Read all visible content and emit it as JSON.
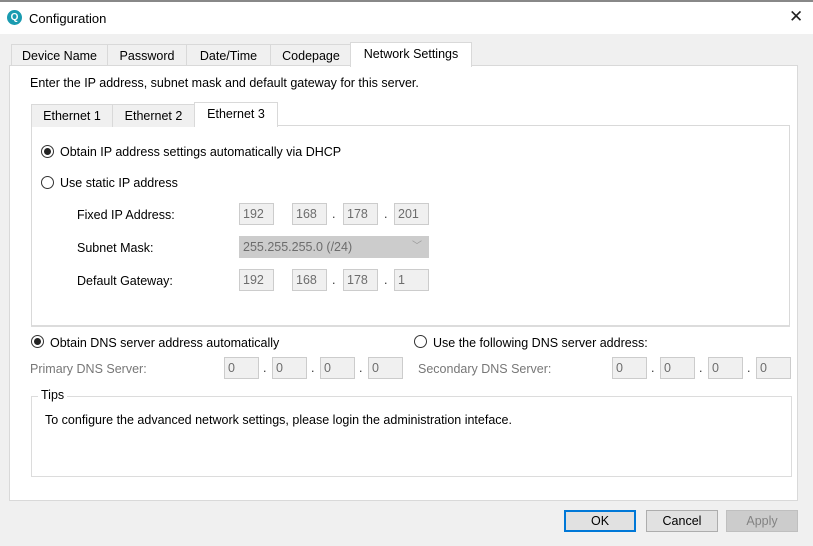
{
  "window": {
    "title": "Configuration",
    "close": "✕",
    "logo": "Q"
  },
  "tabs": [
    {
      "label": "Device Name"
    },
    {
      "label": "Password"
    },
    {
      "label": "Date/Time"
    },
    {
      "label": "Codepage"
    },
    {
      "label": "Network Settings",
      "active": true
    }
  ],
  "intro": "Enter the IP address, subnet mask and default gateway for this server.",
  "eth_tabs": [
    {
      "label": "Ethernet 1"
    },
    {
      "label": "Ethernet 2"
    },
    {
      "label": "Ethernet 3",
      "active": true
    }
  ],
  "ip_mode": {
    "dhcp_label": "Obtain IP address settings automatically via DHCP",
    "static_label": "Use static IP address",
    "selected": "dhcp"
  },
  "fixed_ip": {
    "label": "Fixed IP Address:",
    "octets": [
      "192",
      "168",
      "178",
      "201"
    ]
  },
  "subnet": {
    "label": "Subnet Mask:",
    "value": "255.255.255.0 (/24)"
  },
  "gateway": {
    "label": "Default Gateway:",
    "octets": [
      "192",
      "168",
      "178",
      "1"
    ]
  },
  "dns": {
    "auto_label": "Obtain DNS server address automatically",
    "manual_label": "Use the following DNS server address:",
    "selected": "auto",
    "primary": {
      "label": "Primary DNS Server:",
      "octets": [
        "0",
        "0",
        "0",
        "0"
      ]
    },
    "secondary": {
      "label": "Secondary DNS Server:",
      "octets": [
        "0",
        "0",
        "0",
        "0"
      ]
    }
  },
  "tips": {
    "legend": "Tips",
    "text": "To configure the advanced network settings, please login the administration inteface."
  },
  "buttons": {
    "ok": "OK",
    "cancel": "Cancel",
    "apply": "Apply"
  },
  "dot": "."
}
